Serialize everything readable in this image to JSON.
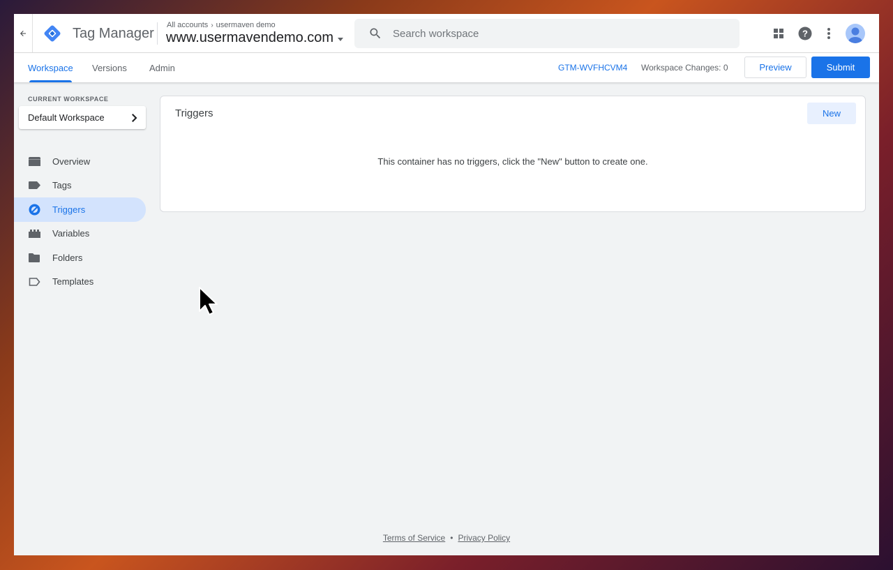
{
  "header": {
    "product_name": "Tag Manager",
    "breadcrumb": {
      "root": "All accounts",
      "account": "usermaven demo"
    },
    "container_name": "www.usermavendemo.com",
    "search_placeholder": "Search workspace"
  },
  "subnav": {
    "tabs": [
      {
        "label": "Workspace",
        "active": true
      },
      {
        "label": "Versions",
        "active": false
      },
      {
        "label": "Admin",
        "active": false
      }
    ],
    "container_id": "GTM-WVFHCVM4",
    "workspace_changes": "Workspace Changes: 0",
    "preview_label": "Preview",
    "submit_label": "Submit"
  },
  "sidebar": {
    "current_workspace_label": "CURRENT WORKSPACE",
    "workspace_name": "Default Workspace",
    "items": [
      {
        "label": "Overview",
        "icon": "overview-icon",
        "active": false
      },
      {
        "label": "Tags",
        "icon": "tag-icon",
        "active": false
      },
      {
        "label": "Triggers",
        "icon": "trigger-icon",
        "active": true
      },
      {
        "label": "Variables",
        "icon": "variables-icon",
        "active": false
      },
      {
        "label": "Folders",
        "icon": "folder-icon",
        "active": false
      },
      {
        "label": "Templates",
        "icon": "template-icon",
        "active": false
      }
    ]
  },
  "main": {
    "title": "Triggers",
    "new_label": "New",
    "empty_message": "This container has no triggers, click the \"New\" button to create one."
  },
  "footer": {
    "terms": "Terms of Service",
    "separator": "•",
    "privacy": "Privacy Policy"
  },
  "colors": {
    "accent": "#1a73e8",
    "active_nav_bg": "#d3e3fd",
    "page_bg": "#f1f3f4"
  }
}
